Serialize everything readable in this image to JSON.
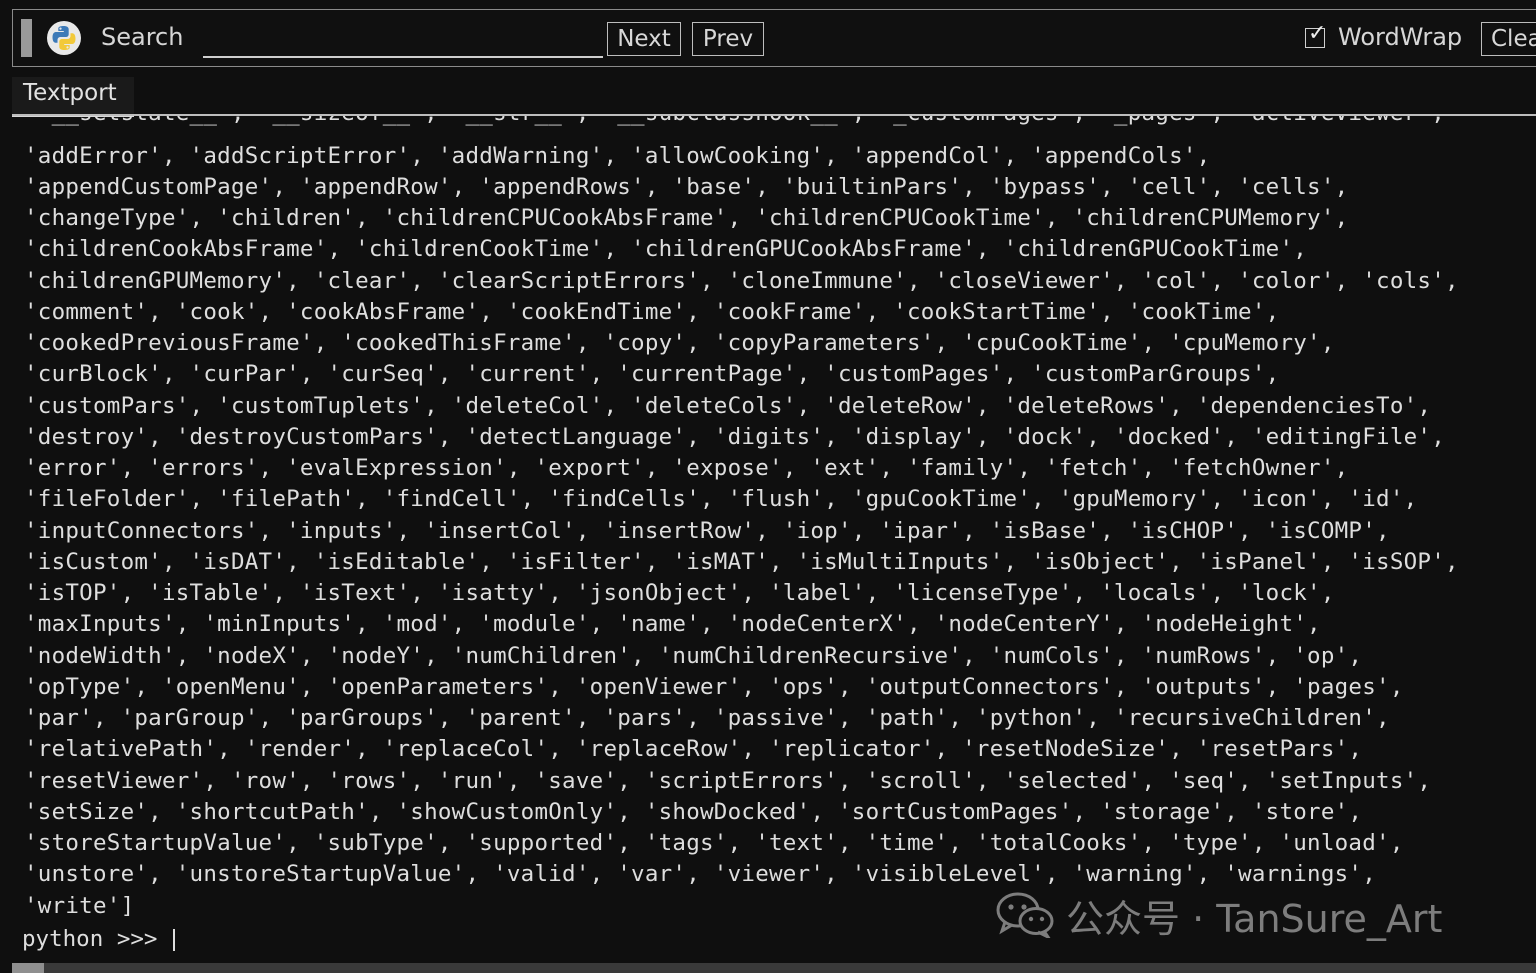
{
  "toolbar": {
    "logo_icon": "python-logo-icon",
    "search_label": "Search",
    "search_value": "",
    "next_label": "Next",
    "prev_label": "Prev",
    "wordwrap_checked": true,
    "wordwrap_label": "WordWrap",
    "clear_label": "Clea"
  },
  "tab": {
    "label": "Textport"
  },
  "console": {
    "lines": [
      " '__setstate__', '__sizeof__', '__str__', '__subclasshook__', '_customPages', '_pages', 'activeViewer',",
      "'addError', 'addScriptError', 'addWarning', 'allowCooking', 'appendCol', 'appendCols',",
      "'appendCustomPage', 'appendRow', 'appendRows', 'base', 'builtinPars', 'bypass', 'cell', 'cells',",
      "'changeType', 'children', 'childrenCPUCookAbsFrame', 'childrenCPUCookTime', 'childrenCPUMemory',",
      "'childrenCookAbsFrame', 'childrenCookTime', 'childrenGPUCookAbsFrame', 'childrenGPUCookTime',",
      "'childrenGPUMemory', 'clear', 'clearScriptErrors', 'cloneImmune', 'closeViewer', 'col', 'color', 'cols',",
      "'comment', 'cook', 'cookAbsFrame', 'cookEndTime', 'cookFrame', 'cookStartTime', 'cookTime',",
      "'cookedPreviousFrame', 'cookedThisFrame', 'copy', 'copyParameters', 'cpuCookTime', 'cpuMemory',",
      "'curBlock', 'curPar', 'curSeq', 'current', 'currentPage', 'customPages', 'customParGroups',",
      "'customPars', 'customTuplets', 'deleteCol', 'deleteCols', 'deleteRow', 'deleteRows', 'dependenciesTo',",
      "'destroy', 'destroyCustomPars', 'detectLanguage', 'digits', 'display', 'dock', 'docked', 'editingFile',",
      "'error', 'errors', 'evalExpression', 'export', 'expose', 'ext', 'family', 'fetch', 'fetchOwner',",
      "'fileFolder', 'filePath', 'findCell', 'findCells', 'flush', 'gpuCookTime', 'gpuMemory', 'icon', 'id',",
      "'inputConnectors', 'inputs', 'insertCol', 'insertRow', 'iop', 'ipar', 'isBase', 'isCHOP', 'isCOMP',",
      "'isCustom', 'isDAT', 'isEditable', 'isFilter', 'isMAT', 'isMultiInputs', 'isObject', 'isPanel', 'isSOP',",
      "'isTOP', 'isTable', 'isText', 'isatty', 'jsonObject', 'label', 'licenseType', 'locals', 'lock',",
      "'maxInputs', 'minInputs', 'mod', 'module', 'name', 'nodeCenterX', 'nodeCenterY', 'nodeHeight',",
      "'nodeWidth', 'nodeX', 'nodeY', 'numChildren', 'numChildrenRecursive', 'numCols', 'numRows', 'op',",
      "'opType', 'openMenu', 'openParameters', 'openViewer', 'ops', 'outputConnectors', 'outputs', 'pages',",
      "'par', 'parGroup', 'parGroups', 'parent', 'pars', 'passive', 'path', 'python', 'recursiveChildren',",
      "'relativePath', 'render', 'replaceCol', 'replaceRow', 'replicator', 'resetNodeSize', 'resetPars',",
      "'resetViewer', 'row', 'rows', 'run', 'save', 'scriptErrors', 'scroll', 'selected', 'seq', 'setInputs',",
      "'setSize', 'shortcutPath', 'showCustomOnly', 'showDocked', 'sortCustomPages', 'storage', 'store',",
      "'storeStartupValue', 'subType', 'supported', 'tags', 'text', 'time', 'totalCooks', 'type', 'unload',",
      "'unstore', 'unstoreStartupValue', 'valid', 'var', 'viewer', 'visibleLevel', 'warning', 'warnings',",
      "'write']"
    ],
    "prompt": "python >>> "
  },
  "watermark": {
    "icon": "wechat-icon",
    "text": "公众号 · TanSure_Art"
  }
}
